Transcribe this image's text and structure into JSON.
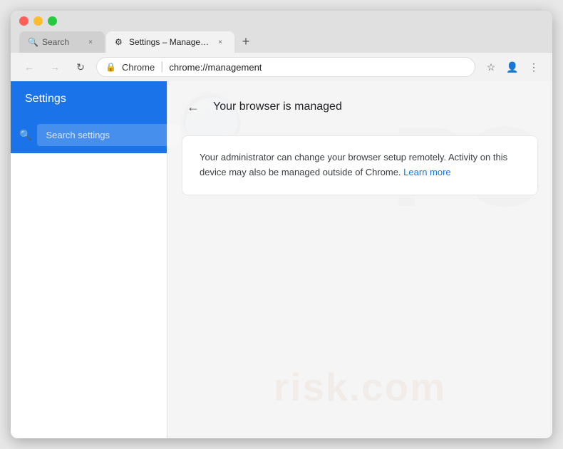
{
  "window": {
    "controls": {
      "close_label": "×",
      "minimize_label": "−",
      "maximize_label": "+"
    }
  },
  "tabs": [
    {
      "id": "search-tab",
      "label": "Search",
      "favicon": "🔍",
      "active": false
    },
    {
      "id": "settings-tab",
      "label": "Settings – Management",
      "favicon": "⚙",
      "active": true
    }
  ],
  "new_tab_btn": "+",
  "nav": {
    "back_icon": "←",
    "forward_icon": "→",
    "reload_icon": "↻",
    "lock_icon": "🔒",
    "chrome_label": "Chrome",
    "separator": "|",
    "address": "chrome://management",
    "bookmark_icon": "☆",
    "profile_icon": "👤",
    "menu_icon": "⋮"
  },
  "sidebar": {
    "title": "Settings",
    "search_placeholder": "Search settings"
  },
  "main": {
    "back_icon": "←",
    "page_title": "Your browser is managed",
    "info_text": "Your administrator can change your browser setup remotely. Activity on this device may also be managed outside of Chrome.",
    "learn_more_label": "Learn more"
  },
  "watermark": {
    "pc_text": "PC",
    "risk_text": "risk.com"
  }
}
